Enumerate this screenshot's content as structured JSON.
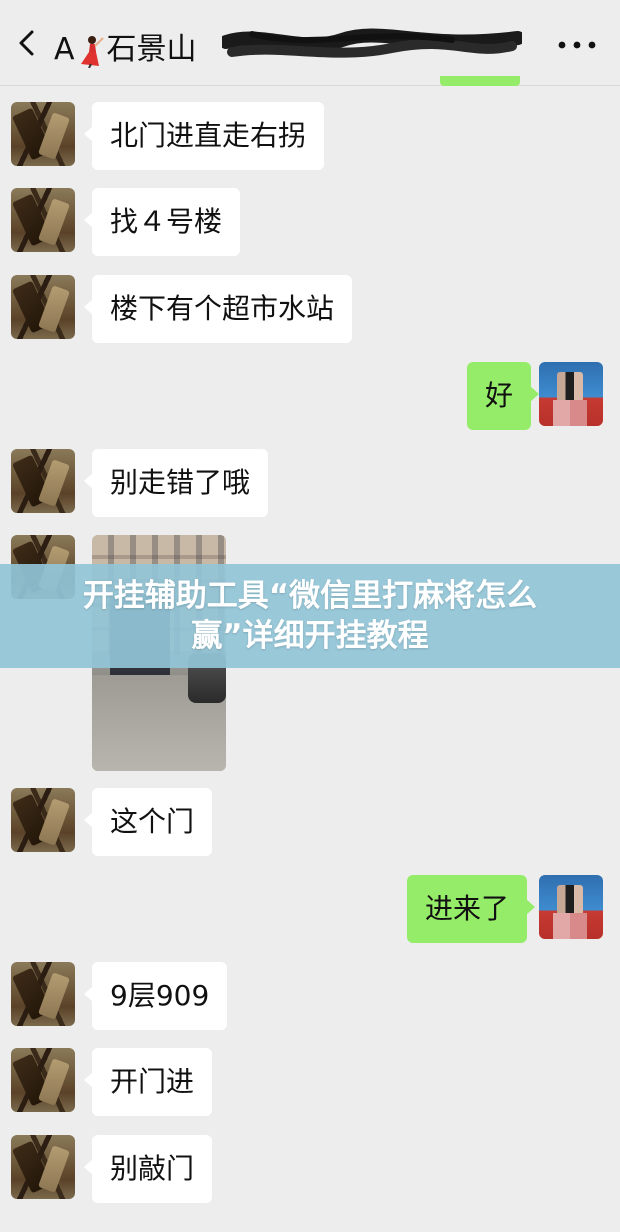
{
  "header": {
    "title_prefix": "A",
    "title_name": "石景山",
    "title_emoji_icon": "flamenco-dancer-icon",
    "more_icon": "more-dots-icon",
    "back_icon": "chevron-left-icon"
  },
  "messages": [
    {
      "side": "left",
      "text": "北门进直走右拐"
    },
    {
      "side": "left",
      "text": "找４号楼"
    },
    {
      "side": "left",
      "text": "楼下有个超市水站"
    },
    {
      "side": "right",
      "text": "好"
    },
    {
      "side": "left",
      "text": "别走错了哦"
    },
    {
      "side": "left",
      "type": "image",
      "description": "photo-of-building-entrance"
    },
    {
      "side": "left",
      "text": "这个门"
    },
    {
      "side": "right",
      "text": "进来了"
    },
    {
      "side": "left",
      "text": "9层909"
    },
    {
      "side": "left",
      "text": "开门进"
    },
    {
      "side": "left",
      "text": "别敲门"
    }
  ],
  "overlay": {
    "line1": "开挂辅助工具“微信里打麻将怎么",
    "line2": "赢”详细开挂教程"
  },
  "colors": {
    "background": "#ededed",
    "bubble_left": "#ffffff",
    "bubble_right": "#95ec69",
    "banner": "#91c4d7"
  }
}
